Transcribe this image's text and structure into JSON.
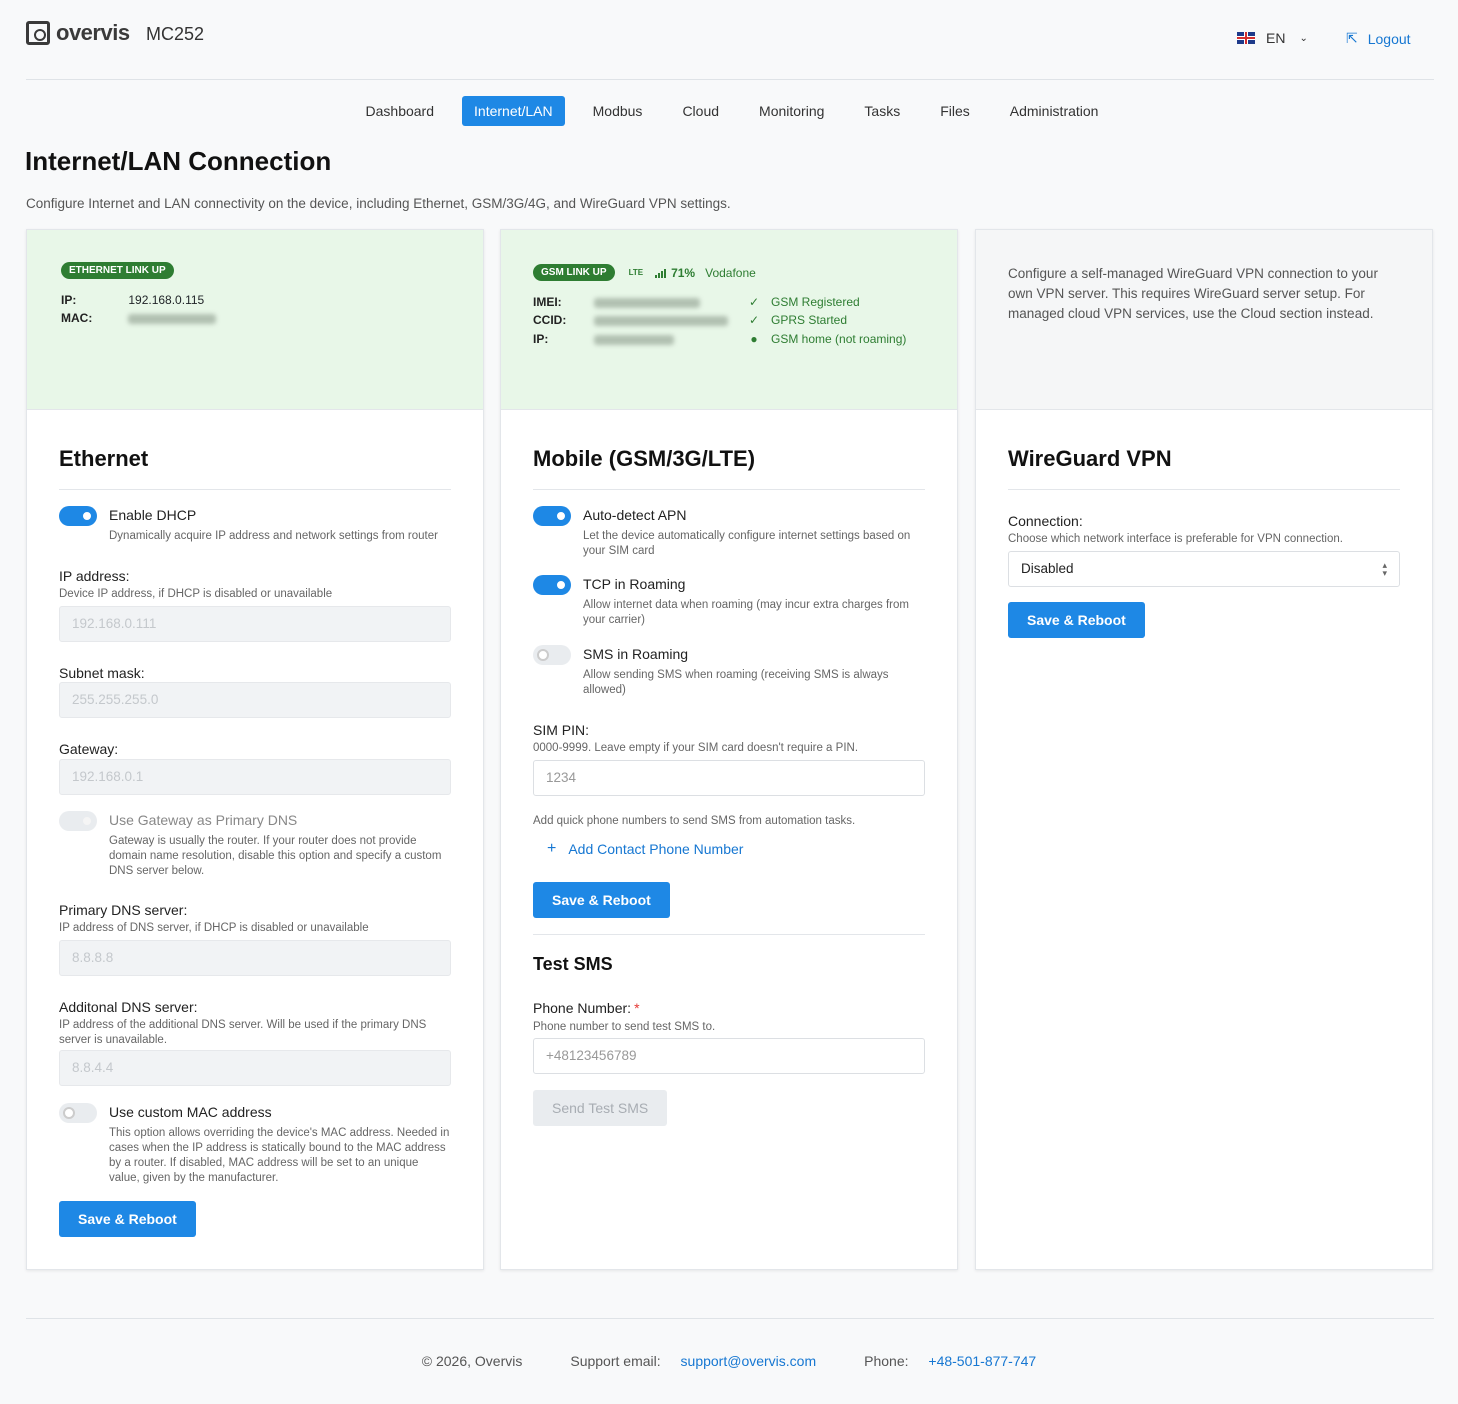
{
  "header": {
    "logo_text": "overvis",
    "model": "MC252",
    "lang": "EN",
    "logout": "Logout"
  },
  "nav": [
    "Dashboard",
    "Internet/LAN",
    "Modbus",
    "Cloud",
    "Monitoring",
    "Tasks",
    "Files",
    "Administration"
  ],
  "nav_active": "Internet/LAN",
  "page": {
    "title": "Internet/LAN Connection",
    "description": "Configure Internet and LAN connectivity on the device, including Ethernet, GSM/3G/4G, and WireGuard VPN settings."
  },
  "ethernet": {
    "badge": "ETHERNET LINK UP",
    "ip_label": "IP:",
    "ip_value": "192.168.0.115",
    "mac_label": "MAC:",
    "title": "Ethernet",
    "dhcp_label": "Enable DHCP",
    "dhcp_desc": "Dynamically acquire IP address and network settings from router",
    "ip_address_label": "IP address:",
    "ip_address_hint": "Device IP address, if DHCP is disabled or unavailable",
    "ip_address_placeholder": "192.168.0.111",
    "subnet_label": "Subnet mask:",
    "subnet_placeholder": "255.255.255.0",
    "gateway_label": "Gateway:",
    "gateway_placeholder": "192.168.0.1",
    "gw_dns_label": "Use Gateway as Primary DNS",
    "gw_dns_desc": "Gateway is usually the router. If your router does not provide domain name resolution, disable this option and specify a custom DNS server below.",
    "primary_dns_label": "Primary DNS server:",
    "primary_dns_hint": "IP address of DNS server, if DHCP is disabled or unavailable",
    "primary_dns_placeholder": "8.8.8.8",
    "add_dns_label": "Additonal DNS server:",
    "add_dns_hint": "IP address of the additional DNS server. Will be used if the primary DNS server is unavailable.",
    "add_dns_placeholder": "8.8.4.4",
    "mac_toggle_label": "Use custom MAC address",
    "mac_toggle_desc": "This option allows overriding the device's MAC address. Needed in cases when the IP address is statically bound to the MAC address by a router. If disabled, MAC address will be set to an unique value, given by the manufacturer.",
    "save": "Save & Reboot"
  },
  "mobile": {
    "badge": "GSM LINK UP",
    "lte": "LTE",
    "signal_pct": "71%",
    "carrier": "Vodafone",
    "imei_label": "IMEI:",
    "ccid_label": "CCID:",
    "ip_label": "IP:",
    "status_registered": "GSM Registered",
    "status_gprs": "GPRS Started",
    "status_home": "GSM home (not roaming)",
    "title": "Mobile (GSM/3G/LTE)",
    "apn_label": "Auto-detect APN",
    "apn_desc": "Let the device automatically configure internet settings based on your SIM card",
    "tcp_label": "TCP in Roaming",
    "tcp_desc": "Allow internet data when roaming (may incur extra charges from your carrier)",
    "sms_label": "SMS in Roaming",
    "sms_desc": "Allow sending SMS when roaming (receiving SMS is always allowed)",
    "pin_label": "SIM PIN:",
    "pin_hint": "0000-9999. Leave empty if your SIM card doesn't require a PIN.",
    "pin_placeholder": "1234",
    "quick_hint": "Add quick phone numbers to send SMS from automation tasks.",
    "add_contact": "Add Contact Phone Number",
    "save": "Save & Reboot",
    "test_title": "Test SMS",
    "phone_label": "Phone Number:",
    "phone_hint": "Phone number to send test SMS to.",
    "phone_placeholder": "+48123456789",
    "send": "Send Test SMS"
  },
  "vpn": {
    "info": "Configure a self-managed WireGuard VPN connection to your own VPN server. This requires WireGuard server setup. For managed cloud VPN services, use the Cloud section instead.",
    "title": "WireGuard VPN",
    "connection_label": "Connection:",
    "connection_hint": "Choose which network interface is preferable for VPN connection.",
    "connection_value": "Disabled",
    "save": "Save & Reboot"
  },
  "footer": {
    "copyright": "© 2026, Overvis",
    "support_label": "Support email:",
    "support_email": "support@overvis.com",
    "phone_label": "Phone:",
    "phone": "+48-501-877-747"
  }
}
